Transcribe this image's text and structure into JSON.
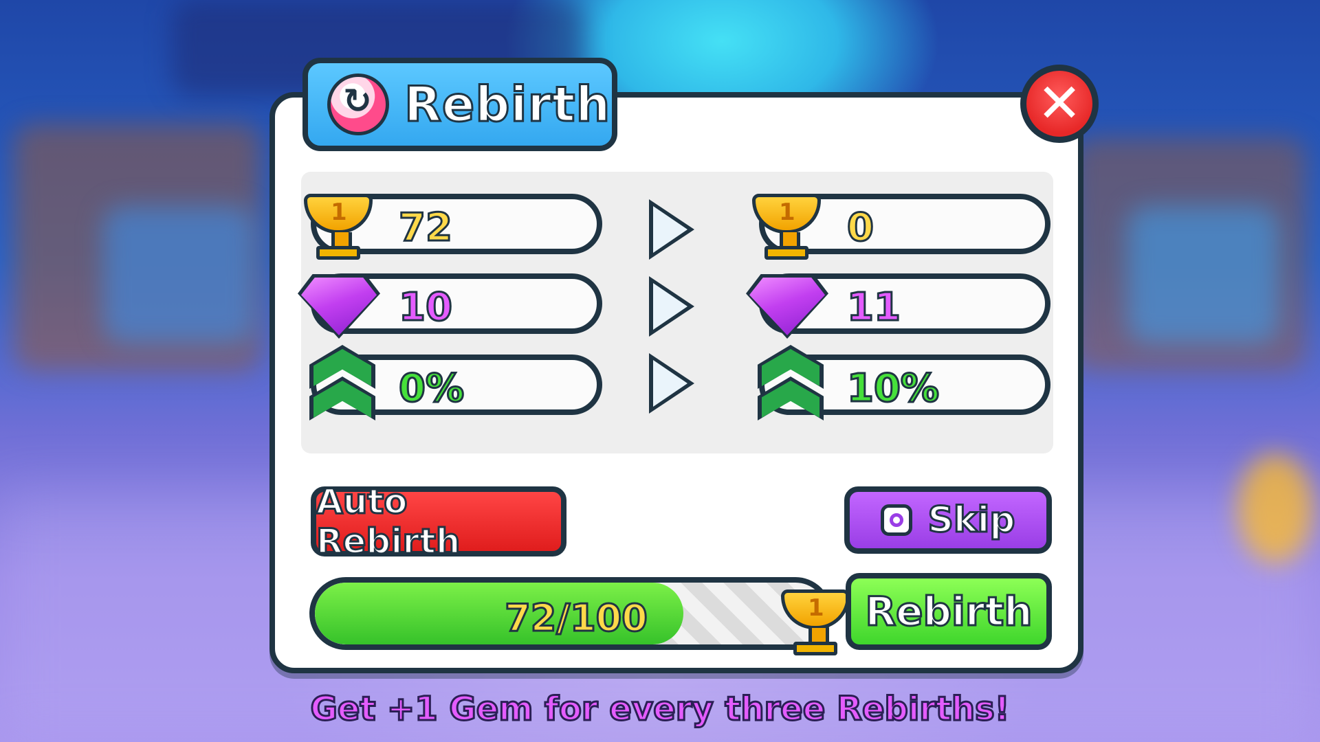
{
  "window": {
    "title": "Rebirth"
  },
  "stats": [
    {
      "kind": "trophy",
      "icon": "trophy-icon",
      "current": "72",
      "next": "0",
      "color": "#ffd94a"
    },
    {
      "kind": "gem",
      "icon": "gem-icon",
      "current": "10",
      "next": "11",
      "color": "#e45cff"
    },
    {
      "kind": "boost",
      "icon": "boost-icon",
      "current": "0%",
      "next": "10%",
      "color": "#46e03a"
    }
  ],
  "buttons": {
    "auto_rebirth": "Auto Rebirth",
    "skip": "Skip",
    "rebirth": "Rebirth",
    "close": "✕"
  },
  "progress": {
    "text": "72/100",
    "current": 72,
    "max": 100,
    "fraction": 0.72
  },
  "footer": "Get +1 Gem for every three Rebirths!",
  "colors": {
    "accent": "#34a8f0",
    "auto": "#e01d1d",
    "skip": "#9a3ee6",
    "rebirth": "#3fd62c",
    "outline": "#1f3443"
  }
}
